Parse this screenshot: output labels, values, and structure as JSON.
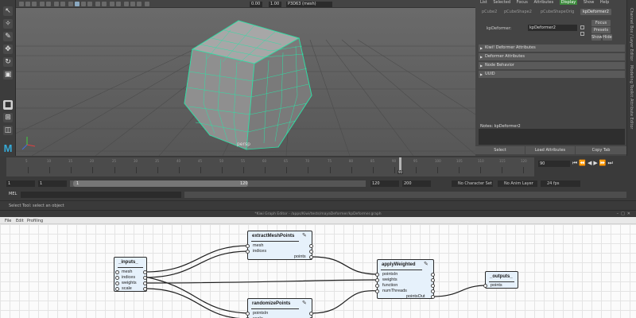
{
  "viewport": {
    "camera_field": "P3D63 (mesh)",
    "value_a": "0.00",
    "value_b": "1.00",
    "camera_label": "persp"
  },
  "attribute_editor": {
    "menu": [
      "List",
      "Selected",
      "Focus",
      "Attributes",
      "Display",
      "Show",
      "Help"
    ],
    "tabs": [
      "pCube2",
      "pCubeShape2",
      "pCubeShapeOrig",
      "kpDeformer2"
    ],
    "active_tab_index": 3,
    "node_label": "kpDeformer:",
    "node_value": "kpDeformer2",
    "focus_btn": "Focus",
    "presets_btn": "Presets",
    "show_btn": "Show",
    "hide_btn": "Hide",
    "sections": [
      "Kiwi! Deformer Attributes",
      "Deformer Attributes",
      "Node Behavior",
      "UUID"
    ],
    "notes_label": "Notes:  kpDeformer2",
    "bottom_buttons": [
      "Select",
      "Load Attributes",
      "Copy Tab"
    ],
    "side_labels": [
      "Channel Box / Layer Editor",
      "Modeling Toolkit",
      "Attribute Editor"
    ]
  },
  "timeline": {
    "tick_labels": [
      "5",
      "10",
      "15",
      "20",
      "25",
      "30",
      "35",
      "40",
      "45",
      "50",
      "55",
      "60",
      "65",
      "70",
      "75",
      "80",
      "85",
      "90",
      "95",
      "100",
      "105",
      "110",
      "115",
      "120"
    ],
    "current_frame": "90",
    "play_field": "90"
  },
  "range": {
    "start_a": "1",
    "start_b": "1",
    "handle_start": "1",
    "handle_end": "120",
    "end_a": "120",
    "end_b": "200",
    "character_set": "No Character Set",
    "anim_layer": "No Anim Layer",
    "fps": "24 fps"
  },
  "command_line": {
    "label": "MEL",
    "help": "Select Tool: select an object"
  },
  "graph_editor": {
    "title": "*Kiwi Graph Editor - /apps/Kiwi/tests/mayaDeformer/kpDeformer.graph",
    "menu": [
      "File",
      "Edit",
      "Profiling"
    ],
    "nodes": {
      "inputs": {
        "title": "_inputs_",
        "ports": [
          "mesh",
          "indices",
          "weights",
          "scale"
        ]
      },
      "extract": {
        "title": "extractMeshPoints",
        "inputs": [
          "mesh",
          "indices"
        ],
        "output": "points"
      },
      "randomize": {
        "title": "randomizePoints",
        "inputs": [
          "pointsIn",
          "scale"
        ]
      },
      "apply": {
        "title": "applyWeighted",
        "inputs": [
          "pointsIn",
          "weights",
          "function",
          "numThreads"
        ],
        "output": "pointsOut"
      },
      "outputs": {
        "title": "_outputs_",
        "ports": [
          "points"
        ]
      }
    }
  }
}
